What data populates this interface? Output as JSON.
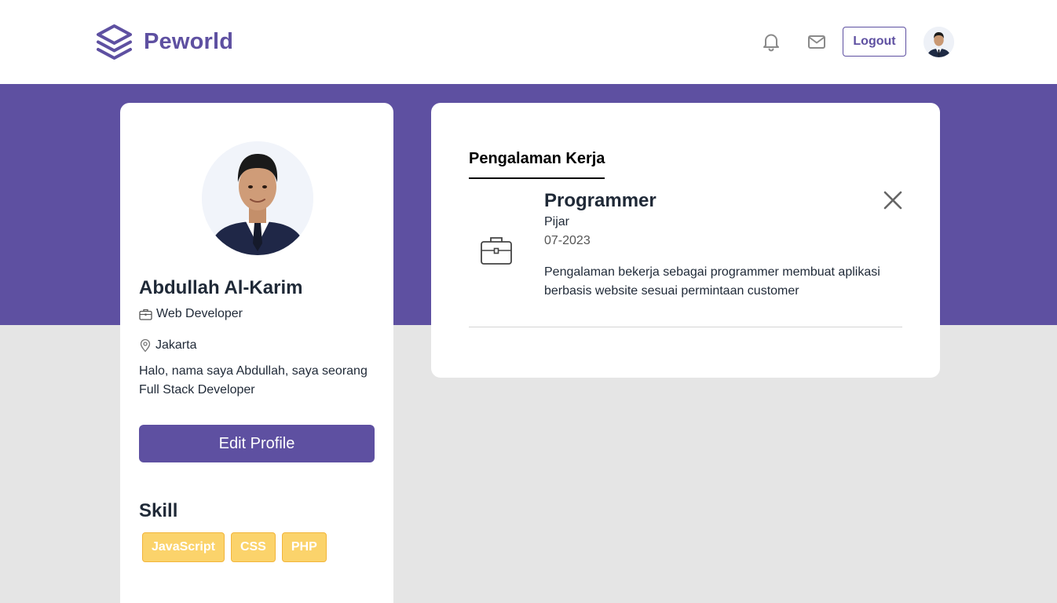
{
  "app": {
    "brand": "Peworld",
    "brand_color": "#5e50a1"
  },
  "navbar": {
    "logout_label": "Logout",
    "icons": [
      "bell-icon",
      "mail-icon"
    ]
  },
  "profile": {
    "name": "Abdullah Al-Karim",
    "job": "Web Developer",
    "location": "Jakarta",
    "bio": "Halo, nama saya Abdullah, saya seorang Full Stack Developer",
    "edit_label": "Edit Profile",
    "skill_title": "Skill",
    "skills": [
      "JavaScript",
      "CSS",
      "PHP"
    ]
  },
  "experience": {
    "tab_label": "Pengalaman Kerja",
    "items": [
      {
        "position": "Programmer",
        "company": "Pijar",
        "date": "07-2023",
        "description": "Pengalaman bekerja sebagai programmer membuat aplikasi berbasis website sesuai permintaan customer"
      }
    ]
  },
  "colors": {
    "banner": "#5e50a1",
    "background": "#e5e5e5",
    "skill_badge": "#fbd36b"
  }
}
